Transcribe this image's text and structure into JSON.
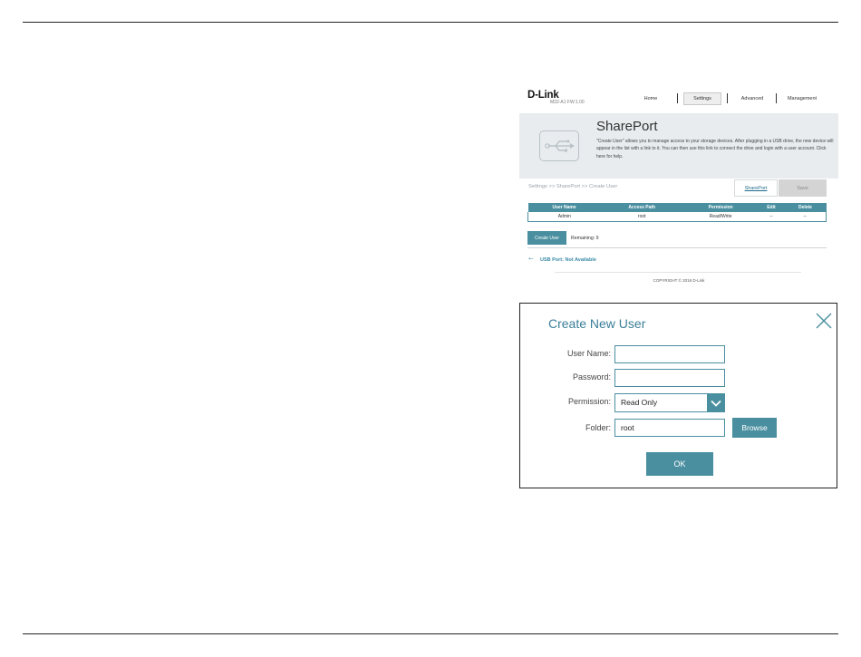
{
  "router": {
    "brand": "D-Link",
    "model": "M32-A1   FW:1.00",
    "nav": {
      "home": "Home",
      "settings": "Settings",
      "advanced": "Advanced",
      "management": "Management"
    },
    "page_title": "SharePort",
    "description": "\"Create User\" allows you to manage access to your storage devices. After plugging in a USB drive, the new device will appear in the list with a link to it. You can then use this link to connect the drive and login with a user account. Click here for help.",
    "breadcrumb": "Settings >> SharePort >> Create User",
    "shareport_link": "SharePort",
    "save_label": "Save",
    "table": {
      "headers": [
        "User Name",
        "Access Path",
        "Permission",
        "Edit",
        "Delete"
      ],
      "rows": [
        [
          "Admin",
          "root",
          "Read/Write",
          "--",
          "--"
        ]
      ]
    },
    "create_user_label": "Create User",
    "remaining": "Remaining: 9",
    "usb_status": "USB Port: Not Available",
    "copyright": "COPYRIGHT © 2016 D-Link",
    "accent_color": "#4a8fa0"
  },
  "modal": {
    "title": "Create New User",
    "close_icon": "close-icon",
    "fields": {
      "username_label": "User Name:",
      "username_value": "",
      "password_label": "Password:",
      "password_value": "",
      "permission_label": "Permission:",
      "permission_value": "Read Only",
      "folder_label": "Folder:",
      "folder_value": "root"
    },
    "browse_label": "Browse",
    "ok_label": "OK"
  }
}
